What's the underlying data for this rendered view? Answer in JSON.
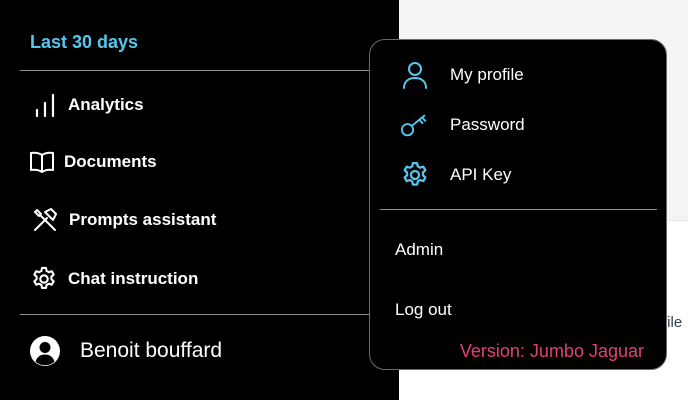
{
  "colors": {
    "accent_cyan": "#56c6ee",
    "version_pink": "#e0407a",
    "sidebar_bg": "#000000"
  },
  "sidebar": {
    "period_label": "Last 30 days",
    "items": [
      {
        "label": "Analytics",
        "icon": "bar-chart-icon"
      },
      {
        "label": "Documents",
        "icon": "book-icon"
      },
      {
        "label": "Prompts assistant",
        "icon": "tools-icon"
      },
      {
        "label": "Chat instruction",
        "icon": "gear-icon"
      }
    ],
    "user_name": "Benoit bouffard"
  },
  "background": {
    "peek_text": "file"
  },
  "user_menu": {
    "items": [
      {
        "label": "My profile",
        "icon": "user-icon"
      },
      {
        "label": "Password",
        "icon": "key-icon"
      },
      {
        "label": "API Key",
        "icon": "gear-icon"
      }
    ],
    "admin_label": "Admin",
    "logout_label": "Log out",
    "version": "Version: Jumbo Jaguar"
  }
}
